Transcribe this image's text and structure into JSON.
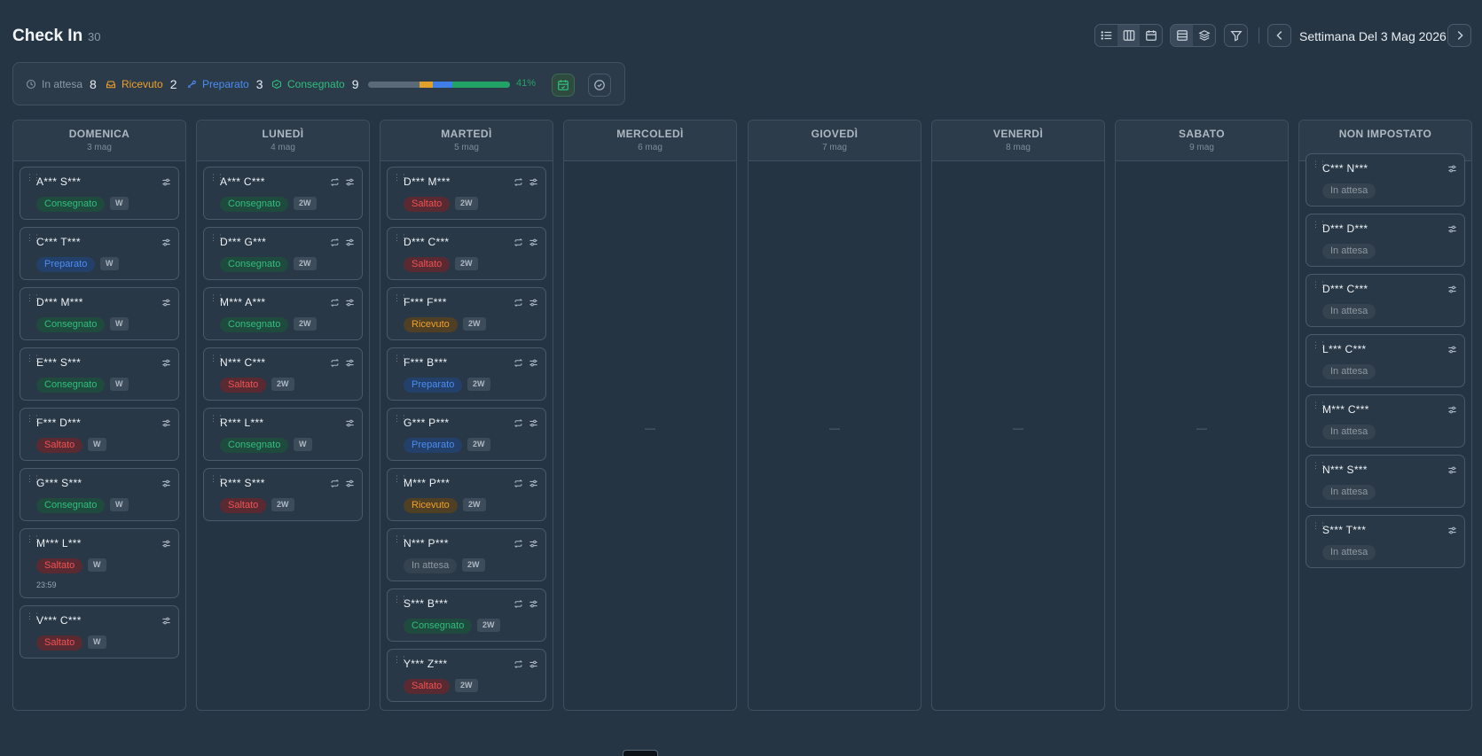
{
  "header": {
    "title": "Check In",
    "count": "30",
    "week_label": "Settimana Del 3 Mag 2026"
  },
  "icons": {
    "list_view": "list-icon",
    "columns_view": "columns-icon",
    "calendar_view": "calendar-icon",
    "compact_view": "rows-icon",
    "layers_view": "layers-icon",
    "filter": "filter-icon",
    "prev": "chevron-left-icon",
    "next": "chevron-right-icon"
  },
  "stats": {
    "in_attesa": {
      "label": "In attesa",
      "value": "8",
      "color": "#8b98a6"
    },
    "ricevuto": {
      "label": "Ricevuto",
      "value": "2",
      "color": "#f0a12b"
    },
    "preparato": {
      "label": "Preparato",
      "value": "3",
      "color": "#4b8df2"
    },
    "consegnato": {
      "label": "Consegnato",
      "value": "9",
      "color": "#2fbf7d"
    },
    "percent": "41%",
    "progress": {
      "ricevuto": 0.0909,
      "preparato": 0.1364,
      "consegnato": 0.4091
    }
  },
  "columns": [
    {
      "name": "DOMENICA",
      "date": "3 mag",
      "empty": "",
      "cards": [
        {
          "name": "A*** S***",
          "status": "Consegnato",
          "status_key": "consegnato",
          "tag": "W",
          "repeat": false
        },
        {
          "name": "C*** T***",
          "status": "Preparato",
          "status_key": "preparato",
          "tag": "W",
          "repeat": false
        },
        {
          "name": "D*** M***",
          "status": "Consegnato",
          "status_key": "consegnato",
          "tag": "W",
          "repeat": false
        },
        {
          "name": "E*** S***",
          "status": "Consegnato",
          "status_key": "consegnato",
          "tag": "W",
          "repeat": false
        },
        {
          "name": "F*** D***",
          "status": "Saltato",
          "status_key": "saltato",
          "tag": "W",
          "repeat": false
        },
        {
          "name": "G*** S***",
          "status": "Consegnato",
          "status_key": "consegnato",
          "tag": "W",
          "repeat": false
        },
        {
          "name": "M*** L***",
          "status": "Saltato",
          "status_key": "saltato",
          "tag": "W",
          "repeat": false,
          "time": "23:59"
        },
        {
          "name": "V*** C***",
          "status": "Saltato",
          "status_key": "saltato",
          "tag": "W",
          "repeat": false
        }
      ]
    },
    {
      "name": "LUNEDÌ",
      "date": "4 mag",
      "empty": "",
      "cards": [
        {
          "name": "A*** C***",
          "status": "Consegnato",
          "status_key": "consegnato",
          "tag": "2W",
          "repeat": true
        },
        {
          "name": "D*** G***",
          "status": "Consegnato",
          "status_key": "consegnato",
          "tag": "2W",
          "repeat": true
        },
        {
          "name": "M*** A***",
          "status": "Consegnato",
          "status_key": "consegnato",
          "tag": "2W",
          "repeat": true
        },
        {
          "name": "N*** C***",
          "status": "Saltato",
          "status_key": "saltato",
          "tag": "2W",
          "repeat": true
        },
        {
          "name": "R*** L***",
          "status": "Consegnato",
          "status_key": "consegnato",
          "tag": "W",
          "repeat": false
        },
        {
          "name": "R*** S***",
          "status": "Saltato",
          "status_key": "saltato",
          "tag": "2W",
          "repeat": true
        }
      ]
    },
    {
      "name": "MARTEDÌ",
      "date": "5 mag",
      "empty": "",
      "cards": [
        {
          "name": "D*** M***",
          "status": "Saltato",
          "status_key": "saltato",
          "tag": "2W",
          "repeat": true
        },
        {
          "name": "D*** C***",
          "status": "Saltato",
          "status_key": "saltato",
          "tag": "2W",
          "repeat": true
        },
        {
          "name": "F*** F***",
          "status": "Ricevuto",
          "status_key": "ricevuto",
          "tag": "2W",
          "repeat": true
        },
        {
          "name": "F*** B***",
          "status": "Preparato",
          "status_key": "preparato",
          "tag": "2W",
          "repeat": true
        },
        {
          "name": "G*** P***",
          "status": "Preparato",
          "status_key": "preparato",
          "tag": "2W",
          "repeat": true
        },
        {
          "name": "M*** P***",
          "status": "Ricevuto",
          "status_key": "ricevuto",
          "tag": "2W",
          "repeat": true
        },
        {
          "name": "N*** P***",
          "status": "In attesa",
          "status_key": "attesa",
          "tag": "2W",
          "repeat": true
        },
        {
          "name": "S*** B***",
          "status": "Consegnato",
          "status_key": "consegnato",
          "tag": "2W",
          "repeat": true
        },
        {
          "name": "Y*** Z***",
          "status": "Saltato",
          "status_key": "saltato",
          "tag": "2W",
          "repeat": true
        }
      ]
    },
    {
      "name": "MERCOLEDÌ",
      "date": "6 mag",
      "empty": "—",
      "cards": []
    },
    {
      "name": "GIOVEDÌ",
      "date": "7 mag",
      "empty": "—",
      "cards": []
    },
    {
      "name": "VENERDÌ",
      "date": "8 mag",
      "empty": "—",
      "cards": []
    },
    {
      "name": "SABATO",
      "date": "9 mag",
      "empty": "—",
      "cards": []
    },
    {
      "name": "NON IMPOSTATO",
      "date": "",
      "empty": "",
      "cards": [
        {
          "name": "C*** N***",
          "status": "In attesa",
          "status_key": "attesa",
          "tag": "",
          "repeat": false
        },
        {
          "name": "D*** D***",
          "status": "In attesa",
          "status_key": "attesa",
          "tag": "",
          "repeat": false
        },
        {
          "name": "D*** C***",
          "status": "In attesa",
          "status_key": "attesa",
          "tag": "",
          "repeat": false
        },
        {
          "name": "L*** C***",
          "status": "In attesa",
          "status_key": "attesa",
          "tag": "",
          "repeat": false
        },
        {
          "name": "M*** C***",
          "status": "In attesa",
          "status_key": "attesa",
          "tag": "",
          "repeat": false
        },
        {
          "name": "N*** S***",
          "status": "In attesa",
          "status_key": "attesa",
          "tag": "",
          "repeat": false
        },
        {
          "name": "S*** T***",
          "status": "In attesa",
          "status_key": "attesa",
          "tag": "",
          "repeat": false
        }
      ]
    }
  ]
}
